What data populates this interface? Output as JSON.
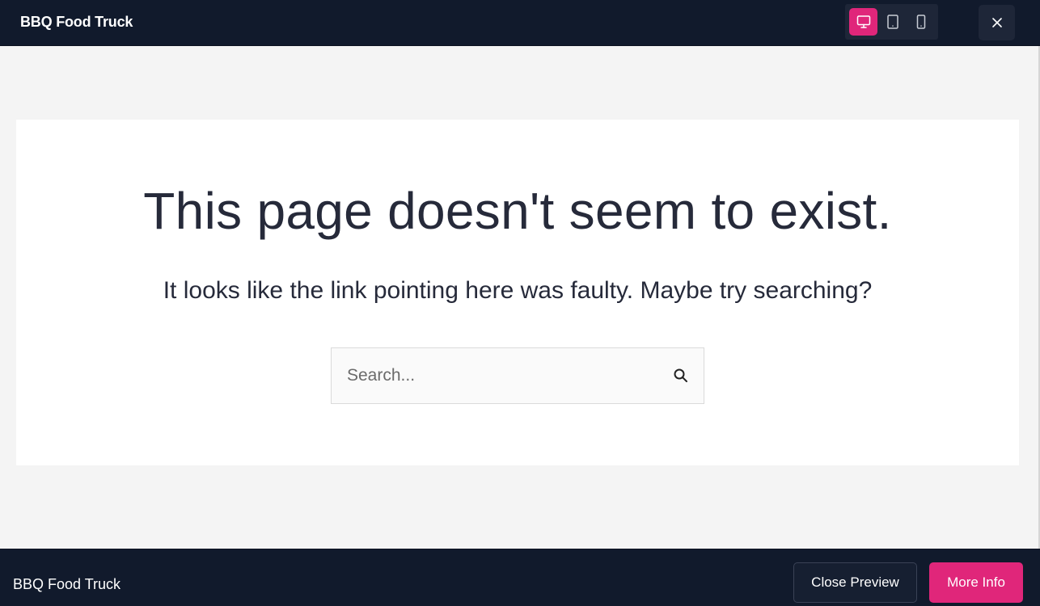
{
  "topbar": {
    "title": "BBQ Food Truck",
    "devices": [
      {
        "name": "desktop",
        "icon": "monitor-icon",
        "active": true
      },
      {
        "name": "tablet",
        "icon": "tablet-icon",
        "active": false
      },
      {
        "name": "mobile",
        "icon": "mobile-icon",
        "active": false
      }
    ],
    "close_icon": "close-icon"
  },
  "main": {
    "headline": "This page doesn't seem to exist.",
    "subline": "It looks like the link pointing here was faulty. Maybe try searching?",
    "search": {
      "placeholder": "Search...",
      "value": "",
      "icon": "search-icon"
    }
  },
  "bottombar": {
    "title": "BBQ Food Truck",
    "close_preview_label": "Close Preview",
    "more_info_label": "More Info"
  },
  "colors": {
    "bar_background": "#111a2c",
    "accent": "#e0267a",
    "page_background": "#f4f4f4",
    "card_background": "#ffffff",
    "text": "#262a3a"
  }
}
